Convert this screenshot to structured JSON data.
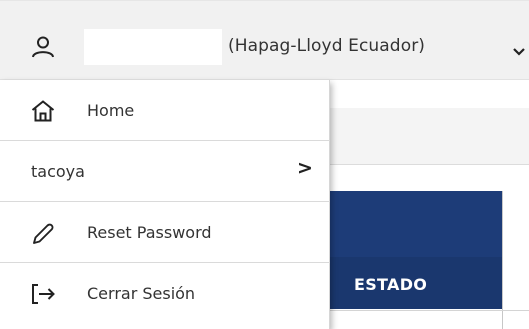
{
  "header": {
    "company": "(Hapag-Lloyd Ecuador)",
    "user_icon": "user-icon",
    "chevron_icon": "chevron-down-icon"
  },
  "dropdown": {
    "items": [
      {
        "label": "Home",
        "icon": "home-icon"
      },
      {
        "label": "tacoya",
        "submenu_indicator": ">"
      },
      {
        "label": "Reset Password",
        "icon": "pencil-icon"
      },
      {
        "label": "Cerrar Sesión",
        "icon": "logout-icon"
      }
    ]
  },
  "table": {
    "column_header": "ESTADO"
  },
  "colors": {
    "topbar_bg": "#f1f1f1",
    "table_header_blue": "#1a376e",
    "text": "#333333"
  }
}
